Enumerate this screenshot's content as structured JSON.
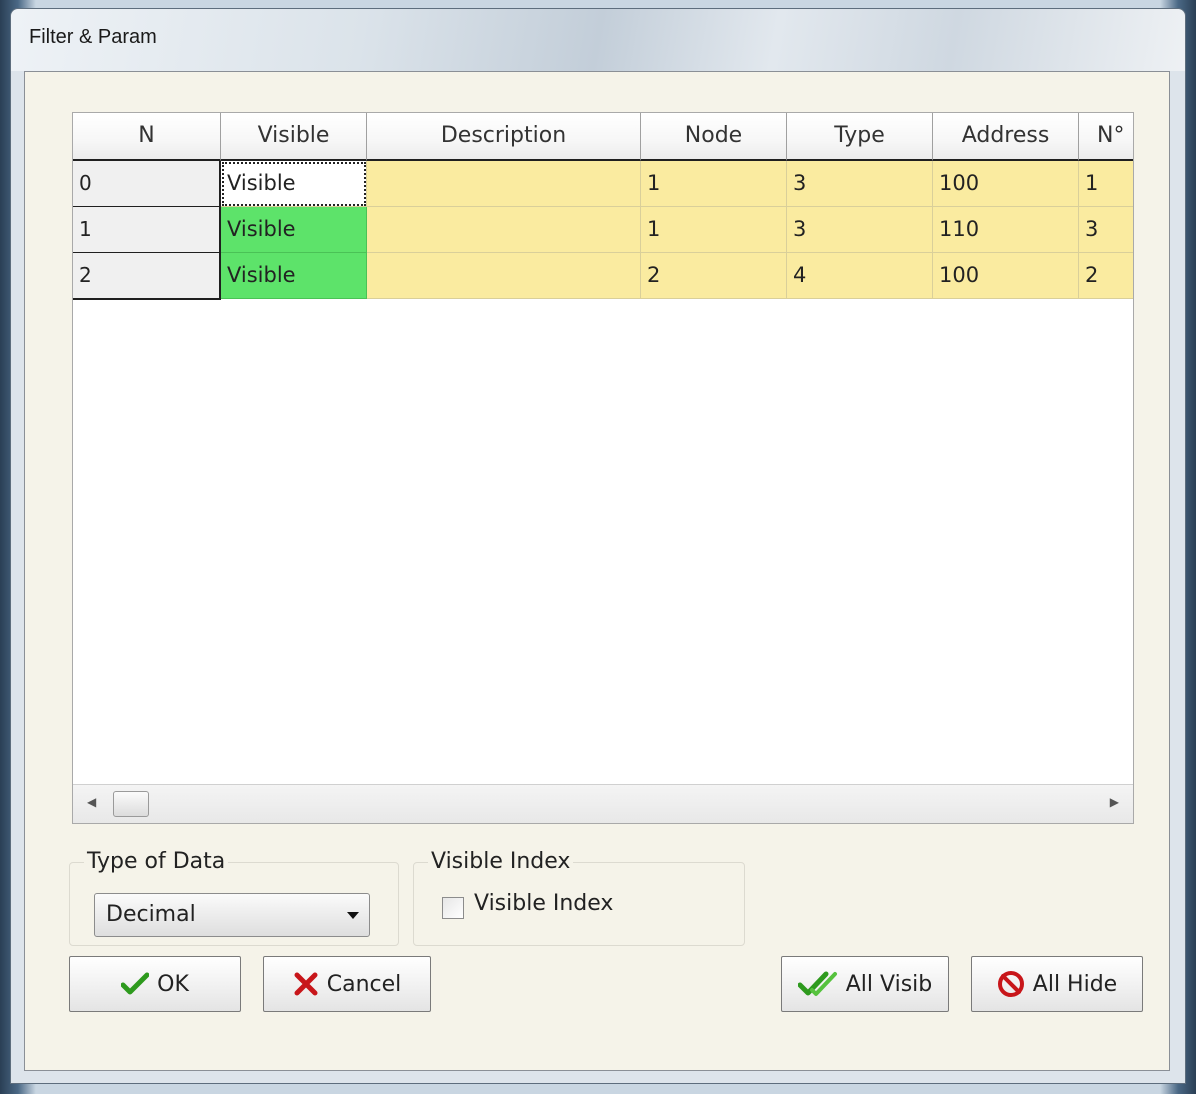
{
  "window": {
    "title": "Filter & Param"
  },
  "grid": {
    "columns": [
      "N",
      "Visible",
      "Description",
      "Node",
      "Type",
      "Address",
      "N°"
    ],
    "rows": [
      {
        "n": "0",
        "visible": "Visible",
        "description": "",
        "node": "1",
        "type": "3",
        "address": "100",
        "count": "1"
      },
      {
        "n": "1",
        "visible": "Visible",
        "description": "",
        "node": "1",
        "type": "3",
        "address": "110",
        "count": "3"
      },
      {
        "n": "2",
        "visible": "Visible",
        "description": "",
        "node": "2",
        "type": "4",
        "address": "100",
        "count": "2"
      }
    ],
    "colors": {
      "data_cell": "#faeba0",
      "visible_on": "#5de36a",
      "selected": "#ffffff"
    }
  },
  "type_of_data": {
    "label": "Type of Data",
    "selected": "Decimal"
  },
  "visible_index": {
    "group_label": "Visible Index",
    "checkbox_label": "Visible Index",
    "checked": false
  },
  "buttons": {
    "ok": "OK",
    "cancel": "Cancel",
    "all_visible": "All Visib",
    "all_hide": "All Hide"
  },
  "icons": {
    "ok": "checkmark-icon",
    "cancel": "red-x-icon",
    "all_visible": "double-check-icon",
    "all_hide": "no-entry-icon"
  }
}
